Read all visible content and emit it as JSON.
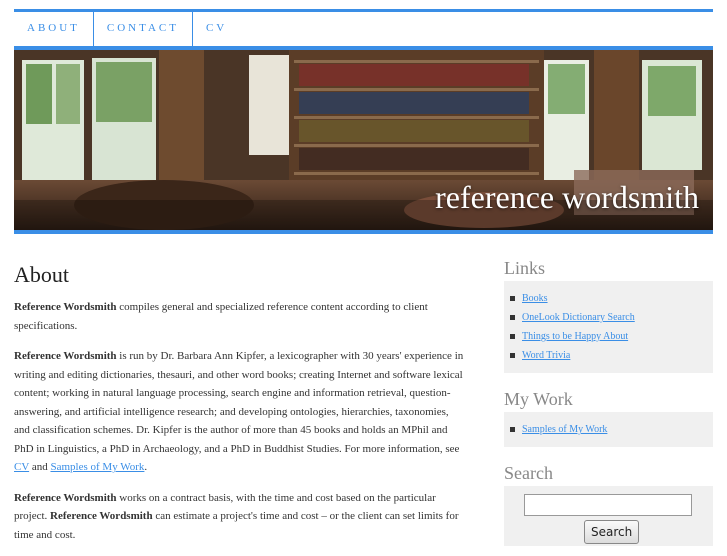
{
  "nav": {
    "items": [
      "About",
      "Contact",
      "CV"
    ]
  },
  "banner": {
    "title": "reference wordsmith"
  },
  "main": {
    "title": "About",
    "p1": {
      "bold": "Reference Wordsmith",
      "text": " compiles general and specialized reference content according to client specifications."
    },
    "p2": {
      "bold": "Reference Wordsmith",
      "text": " is run by Dr. Barbara Ann Kipfer, a lexicographer with 30 years' experience in writing and editing dictionaries, thesauri, and other word books; creating Internet and software lexical content; working in natural language processing, search engine and information retrieval, question-answering, and artificial intelligence research; and developing ontologies, hierarchies, taxonomies, and classification schemes. Dr. Kipfer is the author of more than 45 books and holds an MPhil and PhD in Linguistics, a PhD in Archaeology, and a PhD in Buddhist Studies. For more information, see ",
      "link1": "CV",
      "mid": " and ",
      "link2": "Samples of My Work",
      "end": "."
    },
    "p3": {
      "bold1": "Reference Wordsmith",
      "text1": " works on a contract basis, with the time and cost based on the particular project. ",
      "bold2": "Reference Wordsmith",
      "text2": " can estimate a project's time and cost – or the client can set limits for time and cost."
    }
  },
  "sidebar": {
    "links": {
      "title": "Links",
      "items": [
        "Books",
        "OneLook Dictionary Search",
        "Things to be Happy About",
        "Word Trivia"
      ]
    },
    "work": {
      "title": "My Work",
      "items": [
        "Samples of My Work"
      ]
    },
    "search": {
      "title": "Search",
      "button": "Search",
      "value": ""
    }
  },
  "colors": {
    "accent": "#3a8ee6",
    "widget_bg": "#f0f0f0",
    "widget_title": "#888888"
  }
}
